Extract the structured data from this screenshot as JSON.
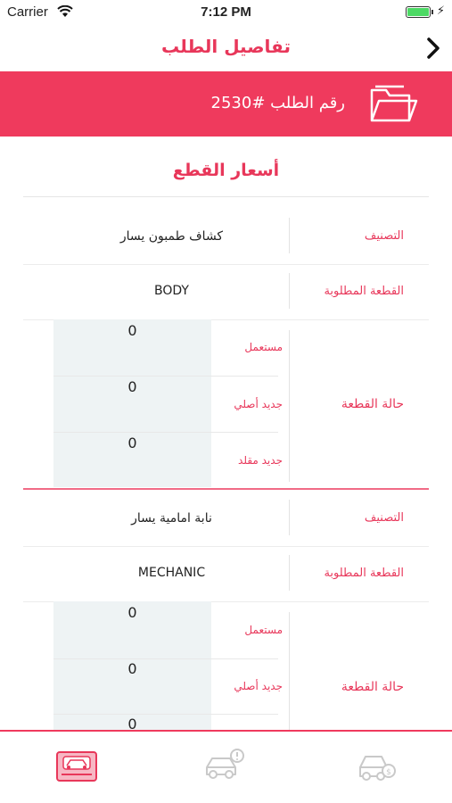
{
  "status": {
    "carrier": "Carrier",
    "time": "7:12 PM"
  },
  "nav": {
    "title": "تفاصيل الطلب"
  },
  "banner": {
    "order_label": "رقم الطلب  #2530"
  },
  "section_title": "أسعار القطع",
  "items": [
    {
      "category_label": "التصنيف",
      "category_value": "كشاف طمبون يسار",
      "part_label": "القطعة المطلوبة",
      "part_value": "BODY",
      "condition_label": "حالة القطعة",
      "conditions": [
        {
          "label": "مستعمل",
          "qty": "0"
        },
        {
          "label": "جديد أصلي",
          "qty": "0"
        },
        {
          "label": "جديد مقلد",
          "qty": "0"
        }
      ]
    },
    {
      "category_label": "التصنيف",
      "category_value": "نابة امامية يسار",
      "part_label": "القطعة المطلوبة",
      "part_value": "MECHANIC",
      "condition_label": "حالة القطعة",
      "conditions": [
        {
          "label": "مستعمل",
          "qty": "0"
        },
        {
          "label": "جديد أصلي",
          "qty": "0"
        },
        {
          "label": "",
          "qty": "0"
        }
      ]
    }
  ],
  "tabs": [
    {
      "name": "orders-tab-icon",
      "active": true
    },
    {
      "name": "car-alert-tab-icon",
      "active": false
    },
    {
      "name": "car-money-tab-icon",
      "active": false
    }
  ],
  "colors": {
    "accent": "#ef3a5d",
    "label": "#e8375a",
    "grey_box": "#eef3f4"
  }
}
